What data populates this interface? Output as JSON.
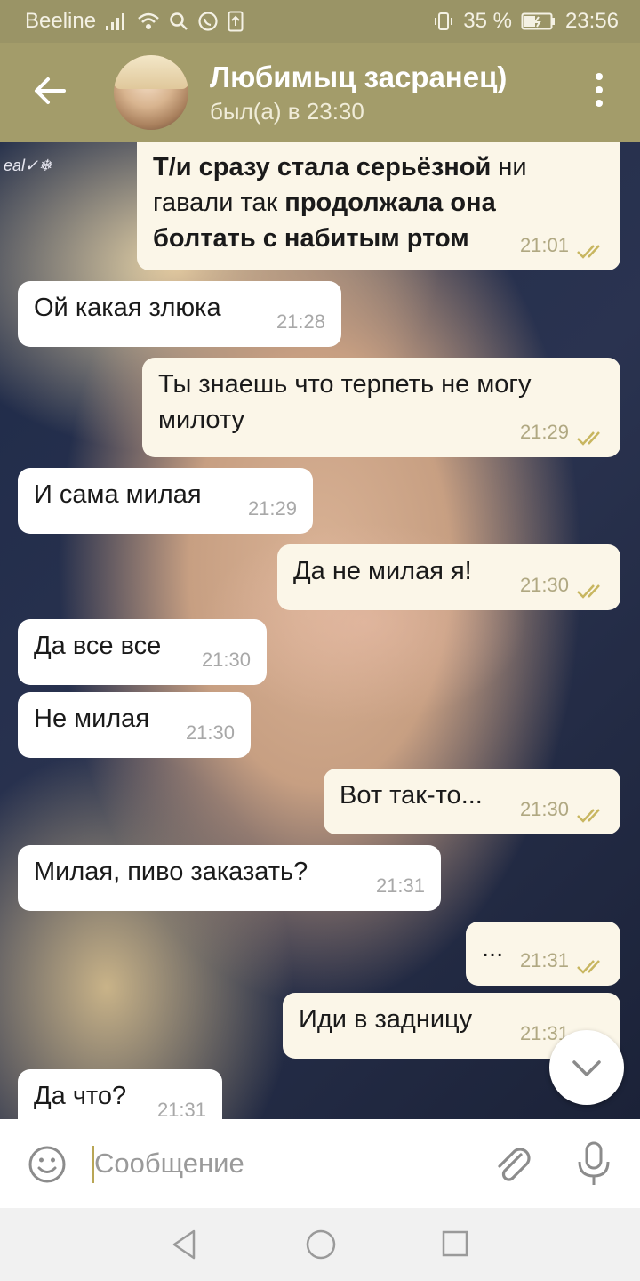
{
  "status_bar": {
    "carrier": "Beeline",
    "battery_percent": "35 %",
    "time": "23:56"
  },
  "header": {
    "title": "Любимыц засранец)",
    "subtitle": "был(а) в 23:30"
  },
  "background": {
    "watermark": "eal✓❄"
  },
  "messages": [
    {
      "dir": "out",
      "parts": [
        {
          "text": "Т/и сразу стала серьёзной",
          "bold": true
        },
        {
          "text": " ни гавали так ",
          "bold": false
        },
        {
          "text": "продолжала она болтать с набитым ртом",
          "bold": true
        }
      ],
      "time": "21:01",
      "read": true
    },
    {
      "dir": "in",
      "text": "Ой какая злюка",
      "time": "21:28"
    },
    {
      "dir": "out",
      "text": "Ты знаешь что терпеть не могу милоту",
      "time": "21:29",
      "read": true
    },
    {
      "dir": "in",
      "text": "И сама милая",
      "time": "21:29"
    },
    {
      "dir": "out",
      "text": "Да не милая я!",
      "time": "21:30",
      "read": true
    },
    {
      "dir": "in",
      "text": "Да все все",
      "time": "21:30"
    },
    {
      "dir": "in",
      "text": "Не милая",
      "time": "21:30"
    },
    {
      "dir": "out",
      "text": "Вот так-то...",
      "time": "21:30",
      "read": true
    },
    {
      "dir": "in",
      "text": "Милая, пиво заказать?",
      "time": "21:31"
    },
    {
      "dir": "out",
      "text": "...",
      "time": "21:31",
      "read": true
    },
    {
      "dir": "out",
      "text": "Иди в задницу",
      "time": "21:31",
      "read": true
    },
    {
      "dir": "in",
      "text": "Да что?",
      "time": "21:31"
    }
  ],
  "composer": {
    "placeholder": "Сообщение"
  },
  "colors": {
    "header": "#a39c6a",
    "status_bar": "#9a9466",
    "outgoing_bubble": "#fbf6e8",
    "incoming_bubble": "#ffffff",
    "read_ticks": "#c8b660"
  },
  "icons": [
    "back-arrow-icon",
    "more-vert-icon",
    "emoji-icon",
    "attach-icon",
    "mic-icon",
    "chevron-down-icon"
  ]
}
